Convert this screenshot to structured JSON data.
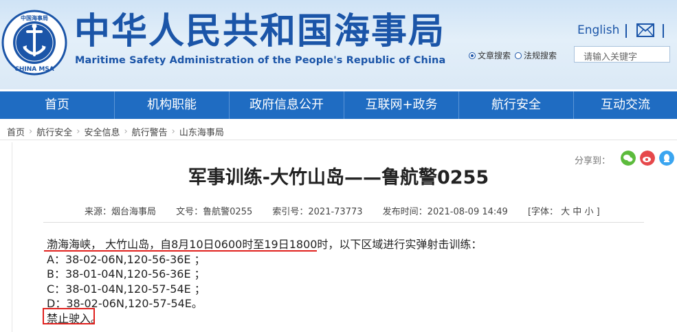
{
  "header": {
    "logo_text_top": "中国海事局",
    "logo_text_bottom": "CHINA MSA",
    "title_cn": "中华人民共和国海事局",
    "title_en": "Maritime Safety Administration of the People's Republic of China",
    "lang_link": "English",
    "search_options": [
      "文章搜索",
      "法规搜索"
    ],
    "search_placeholder": "请输入关键字"
  },
  "nav": {
    "items": [
      "首页",
      "机构职能",
      "政府信息公开",
      "互联网+政务",
      "航行安全",
      "互动交流"
    ]
  },
  "breadcrumb": [
    "首页",
    "航行安全",
    "安全信息",
    "航行警告",
    "山东海事局"
  ],
  "share": {
    "label": "分享到："
  },
  "article": {
    "title": "军事训练-大竹山岛——鲁航警0255",
    "meta": {
      "source": "来源：烟台海事局",
      "doc_no": "文号：鲁航警0255",
      "index_no": "索引号：2021-73773",
      "publish_time": "发布时间：2021-08-09 14:49",
      "font_size": "[字体： 大  中  小 ]"
    },
    "lines": [
      "渤海海峡， 大竹山岛，自8月10日0600时至19日1800时，以下区域进行实弹射击训练：",
      "A：38-02-06N,120-56-36E ；",
      "B：38-01-04N,120-56-36E ；",
      "C：38-01-04N,120-57-54E ；",
      "D：38-02-06N,120-57-54E。",
      "禁止驶入。"
    ]
  },
  "colors": {
    "brand_blue": "#1b55a8",
    "nav_blue": "#1f6cc2",
    "highlight_red": "#e0201d"
  }
}
